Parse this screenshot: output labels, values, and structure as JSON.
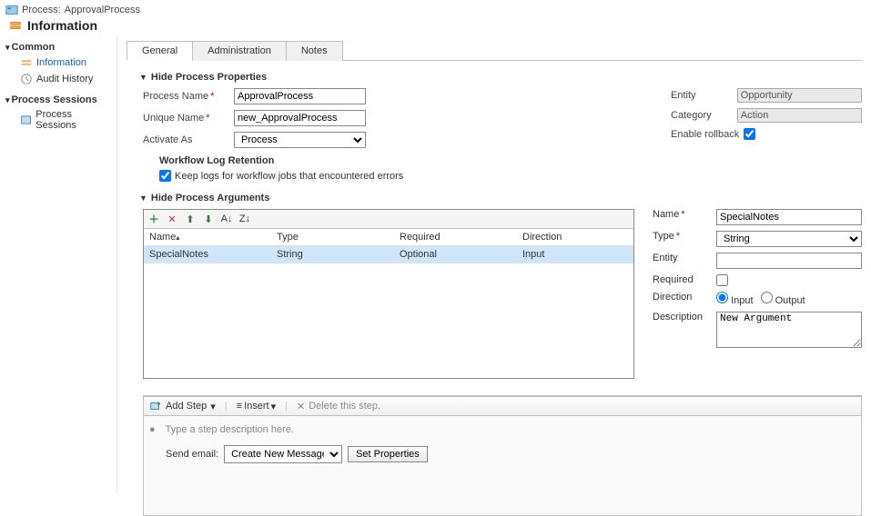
{
  "header": {
    "process_prefix": "Process:",
    "process_name": "ApprovalProcess",
    "title": "Information"
  },
  "sidebar": {
    "common_head": "Common",
    "common_items": [
      "Information",
      "Audit History"
    ],
    "sessions_head": "Process Sessions",
    "sessions_items": [
      "Process Sessions"
    ]
  },
  "tabs": [
    "General",
    "Administration",
    "Notes"
  ],
  "section1_title": "Hide Process Properties",
  "fields": {
    "process_name_label": "Process Name",
    "process_name_value": "ApprovalProcess",
    "unique_name_label": "Unique Name",
    "unique_name_value": "new_ApprovalProcess",
    "activate_as_label": "Activate As",
    "activate_as_value": "Process",
    "entity_label": "Entity",
    "entity_value": "Opportunity",
    "category_label": "Category",
    "category_value": "Action",
    "rollback_label": "Enable rollback"
  },
  "wfret_title": "Workflow Log Retention",
  "wfret_check_label": "Keep logs for workflow jobs that encountered errors",
  "section2_title": "Hide Process Arguments",
  "args_columns": {
    "name": "Name",
    "type": "Type",
    "required": "Required",
    "direction": "Direction"
  },
  "args_rows": [
    {
      "name": "SpecialNotes",
      "type": "String",
      "required": "Optional",
      "direction": "Input"
    }
  ],
  "arg_detail": {
    "name_label": "Name",
    "name_value": "SpecialNotes",
    "type_label": "Type",
    "type_value": "String",
    "entity_label": "Entity",
    "entity_value": "",
    "required_label": "Required",
    "direction_label": "Direction",
    "dir_input": "Input",
    "dir_output": "Output",
    "description_label": "Description",
    "description_value": "New Argument"
  },
  "steps_toolbar": {
    "add_step": "Add Step",
    "insert": "Insert",
    "delete": "Delete this step."
  },
  "steps": {
    "desc_placeholder": "Type a step description here.",
    "send_email_label": "Send email:",
    "send_email_option": "Create New Message",
    "set_properties": "Set Properties"
  }
}
